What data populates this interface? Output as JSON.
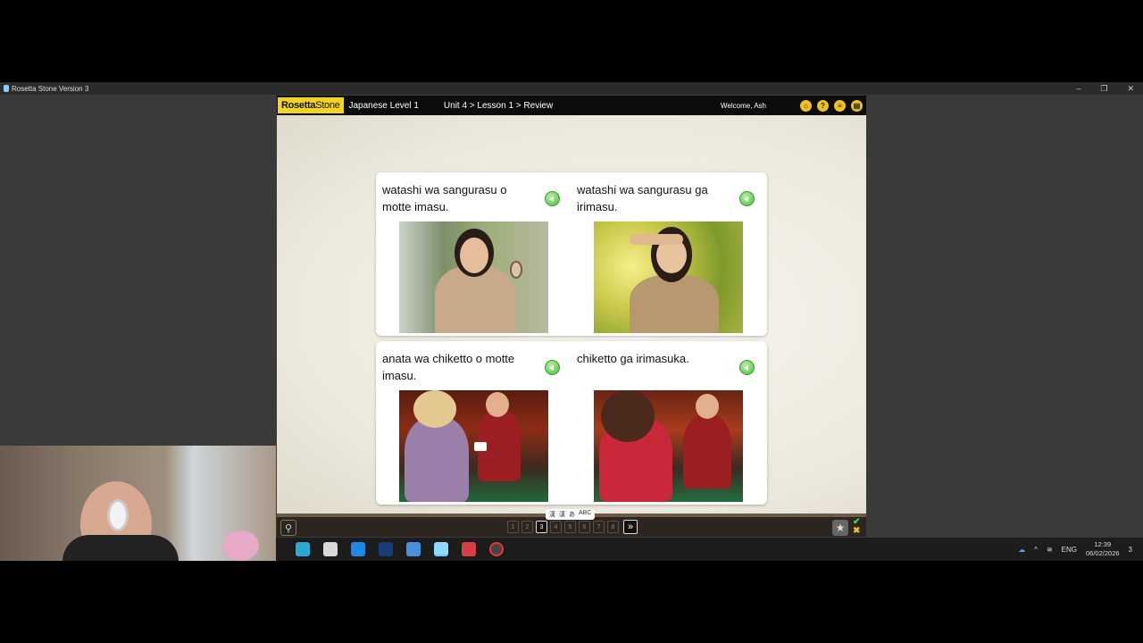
{
  "window": {
    "title": "Rosetta Stone Version 3",
    "controls": [
      "–",
      "❐",
      "✕"
    ]
  },
  "header": {
    "logo_part1": "Rosetta",
    "logo_part2": "Stone",
    "course": "Japanese Level 1",
    "breadcrumb": "Unit 4 > Lesson 1 > Review",
    "welcome": "Welcome, Ash",
    "icons": [
      "home-icon",
      "help-icon",
      "menu-icon",
      "settings-icon"
    ]
  },
  "cards": [
    {
      "left": {
        "phrase": "watashi wa sangurasu o motte imasu."
      },
      "right": {
        "phrase": "watashi wa sangurasu ga irimasu."
      }
    },
    {
      "left": {
        "phrase": "anata wa chiketto o motte imasu."
      },
      "right": {
        "phrase": "chiketto ga irimasuka."
      }
    }
  ],
  "bottom": {
    "pages": [
      "1",
      "2",
      "3",
      "4",
      "5",
      "6",
      "7",
      "8"
    ],
    "current_page": "3",
    "next": "»",
    "scripts": [
      "漢",
      "漢",
      "あ",
      "ABC"
    ]
  },
  "taskbar": {
    "lang": "ENG",
    "time": "12:39",
    "date": "06/02/2026",
    "notifications": "3"
  },
  "colors": {
    "brand_yellow": "#f4d51e",
    "speaker_green": "#4cbb3c",
    "top_bar": "#0c0c0c"
  }
}
